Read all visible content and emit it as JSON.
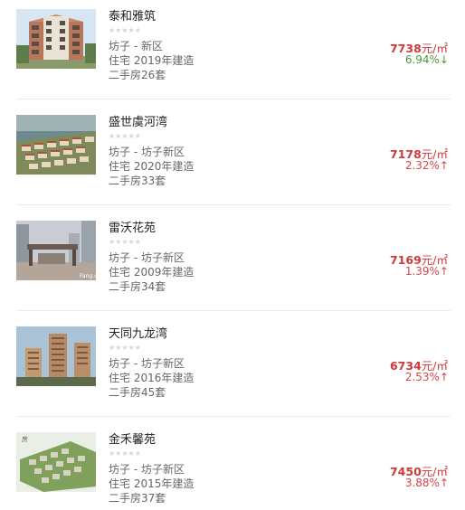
{
  "listings": [
    {
      "name": "泰和雅筑",
      "rating_stars": "★★★★★",
      "location": "坊子 - 新区",
      "type_year": "住宅 2019年建造",
      "resale": "二手房26套",
      "price": "7738",
      "price_unit": "元/㎡",
      "change": "6.94%↓",
      "trend": "down",
      "thumbnail_icon": "building-photo-icon"
    },
    {
      "name": "盛世虞河湾",
      "rating_stars": "★★★★★",
      "location": "坊子 - 坊子新区",
      "type_year": "住宅 2020年建造",
      "resale": "二手房33套",
      "price": "7178",
      "price_unit": "元/㎡",
      "change": "2.32%↑",
      "trend": "up",
      "thumbnail_icon": "aerial-render-icon"
    },
    {
      "name": "雷沃花苑",
      "rating_stars": "★★★★★",
      "location": "坊子 - 坊子新区",
      "type_year": "住宅 2009年建造",
      "resale": "二手房34套",
      "price": "7169",
      "price_unit": "元/㎡",
      "change": "1.39%↑",
      "trend": "up",
      "thumbnail_icon": "gate-photo-icon"
    },
    {
      "name": "天同九龙湾",
      "rating_stars": "★★★★★",
      "location": "坊子 - 坊子新区",
      "type_year": "住宅 2016年建造",
      "resale": "二手房45套",
      "price": "6734",
      "price_unit": "元/㎡",
      "change": "2.53%↑",
      "trend": "up",
      "thumbnail_icon": "towers-photo-icon"
    },
    {
      "name": "金禾馨苑",
      "rating_stars": "★★★★★",
      "location": "坊子 - 坊子新区",
      "type_year": "住宅 2015年建造",
      "resale": "二手房37套",
      "price": "7450",
      "price_unit": "元/㎡",
      "change": "3.88%↑",
      "trend": "up",
      "thumbnail_icon": "aerial-render-icon"
    }
  ],
  "colors": {
    "price": "#cc3a3a",
    "up": "#d94444",
    "down": "#4a9a3a",
    "star": "#d6d6d6"
  }
}
